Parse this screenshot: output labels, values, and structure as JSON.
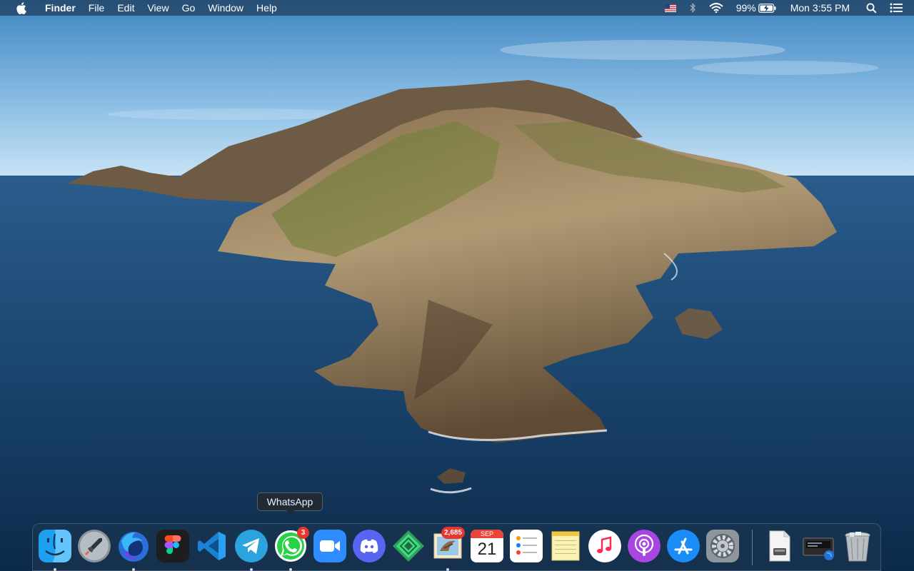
{
  "menubar": {
    "app_name": "Finder",
    "menus": [
      "File",
      "Edit",
      "View",
      "Go",
      "Window",
      "Help"
    ],
    "battery_percent": "99%",
    "clock": "Mon 3:55 PM"
  },
  "tooltip": {
    "text": "WhatsApp"
  },
  "dock": {
    "items": [
      {
        "name": "Finder",
        "icon": "finder-icon"
      },
      {
        "name": "Launchpad",
        "icon": "launchpad-icon"
      },
      {
        "name": "Firefox",
        "icon": "firefox-icon"
      },
      {
        "name": "Figma",
        "icon": "figma-icon"
      },
      {
        "name": "Visual Studio Code",
        "icon": "vscode-icon"
      },
      {
        "name": "Telegram",
        "icon": "telegram-icon"
      },
      {
        "name": "WhatsApp",
        "icon": "whatsapp-icon",
        "badge": "3"
      },
      {
        "name": "Zoom",
        "icon": "zoom-icon"
      },
      {
        "name": "Discord",
        "icon": "discord-icon"
      },
      {
        "name": "Android Studio",
        "icon": "android-studio-icon"
      },
      {
        "name": "Mail",
        "icon": "mail-icon",
        "badge": "2,685"
      },
      {
        "name": "Calendar",
        "icon": "calendar-icon",
        "month": "SEP",
        "day": "21"
      },
      {
        "name": "Reminders",
        "icon": "reminders-icon"
      },
      {
        "name": "Notes",
        "icon": "notes-icon"
      },
      {
        "name": "Music",
        "icon": "music-icon"
      },
      {
        "name": "Podcasts",
        "icon": "podcasts-icon"
      },
      {
        "name": "App Store",
        "icon": "app-store-icon"
      },
      {
        "name": "System Preferences",
        "icon": "system-preferences-icon"
      },
      {
        "name": "Documents",
        "icon": "document-stack-icon"
      },
      {
        "name": "Downloads",
        "icon": "downloads-stack-icon"
      },
      {
        "name": "Trash",
        "icon": "trash-icon"
      }
    ]
  }
}
